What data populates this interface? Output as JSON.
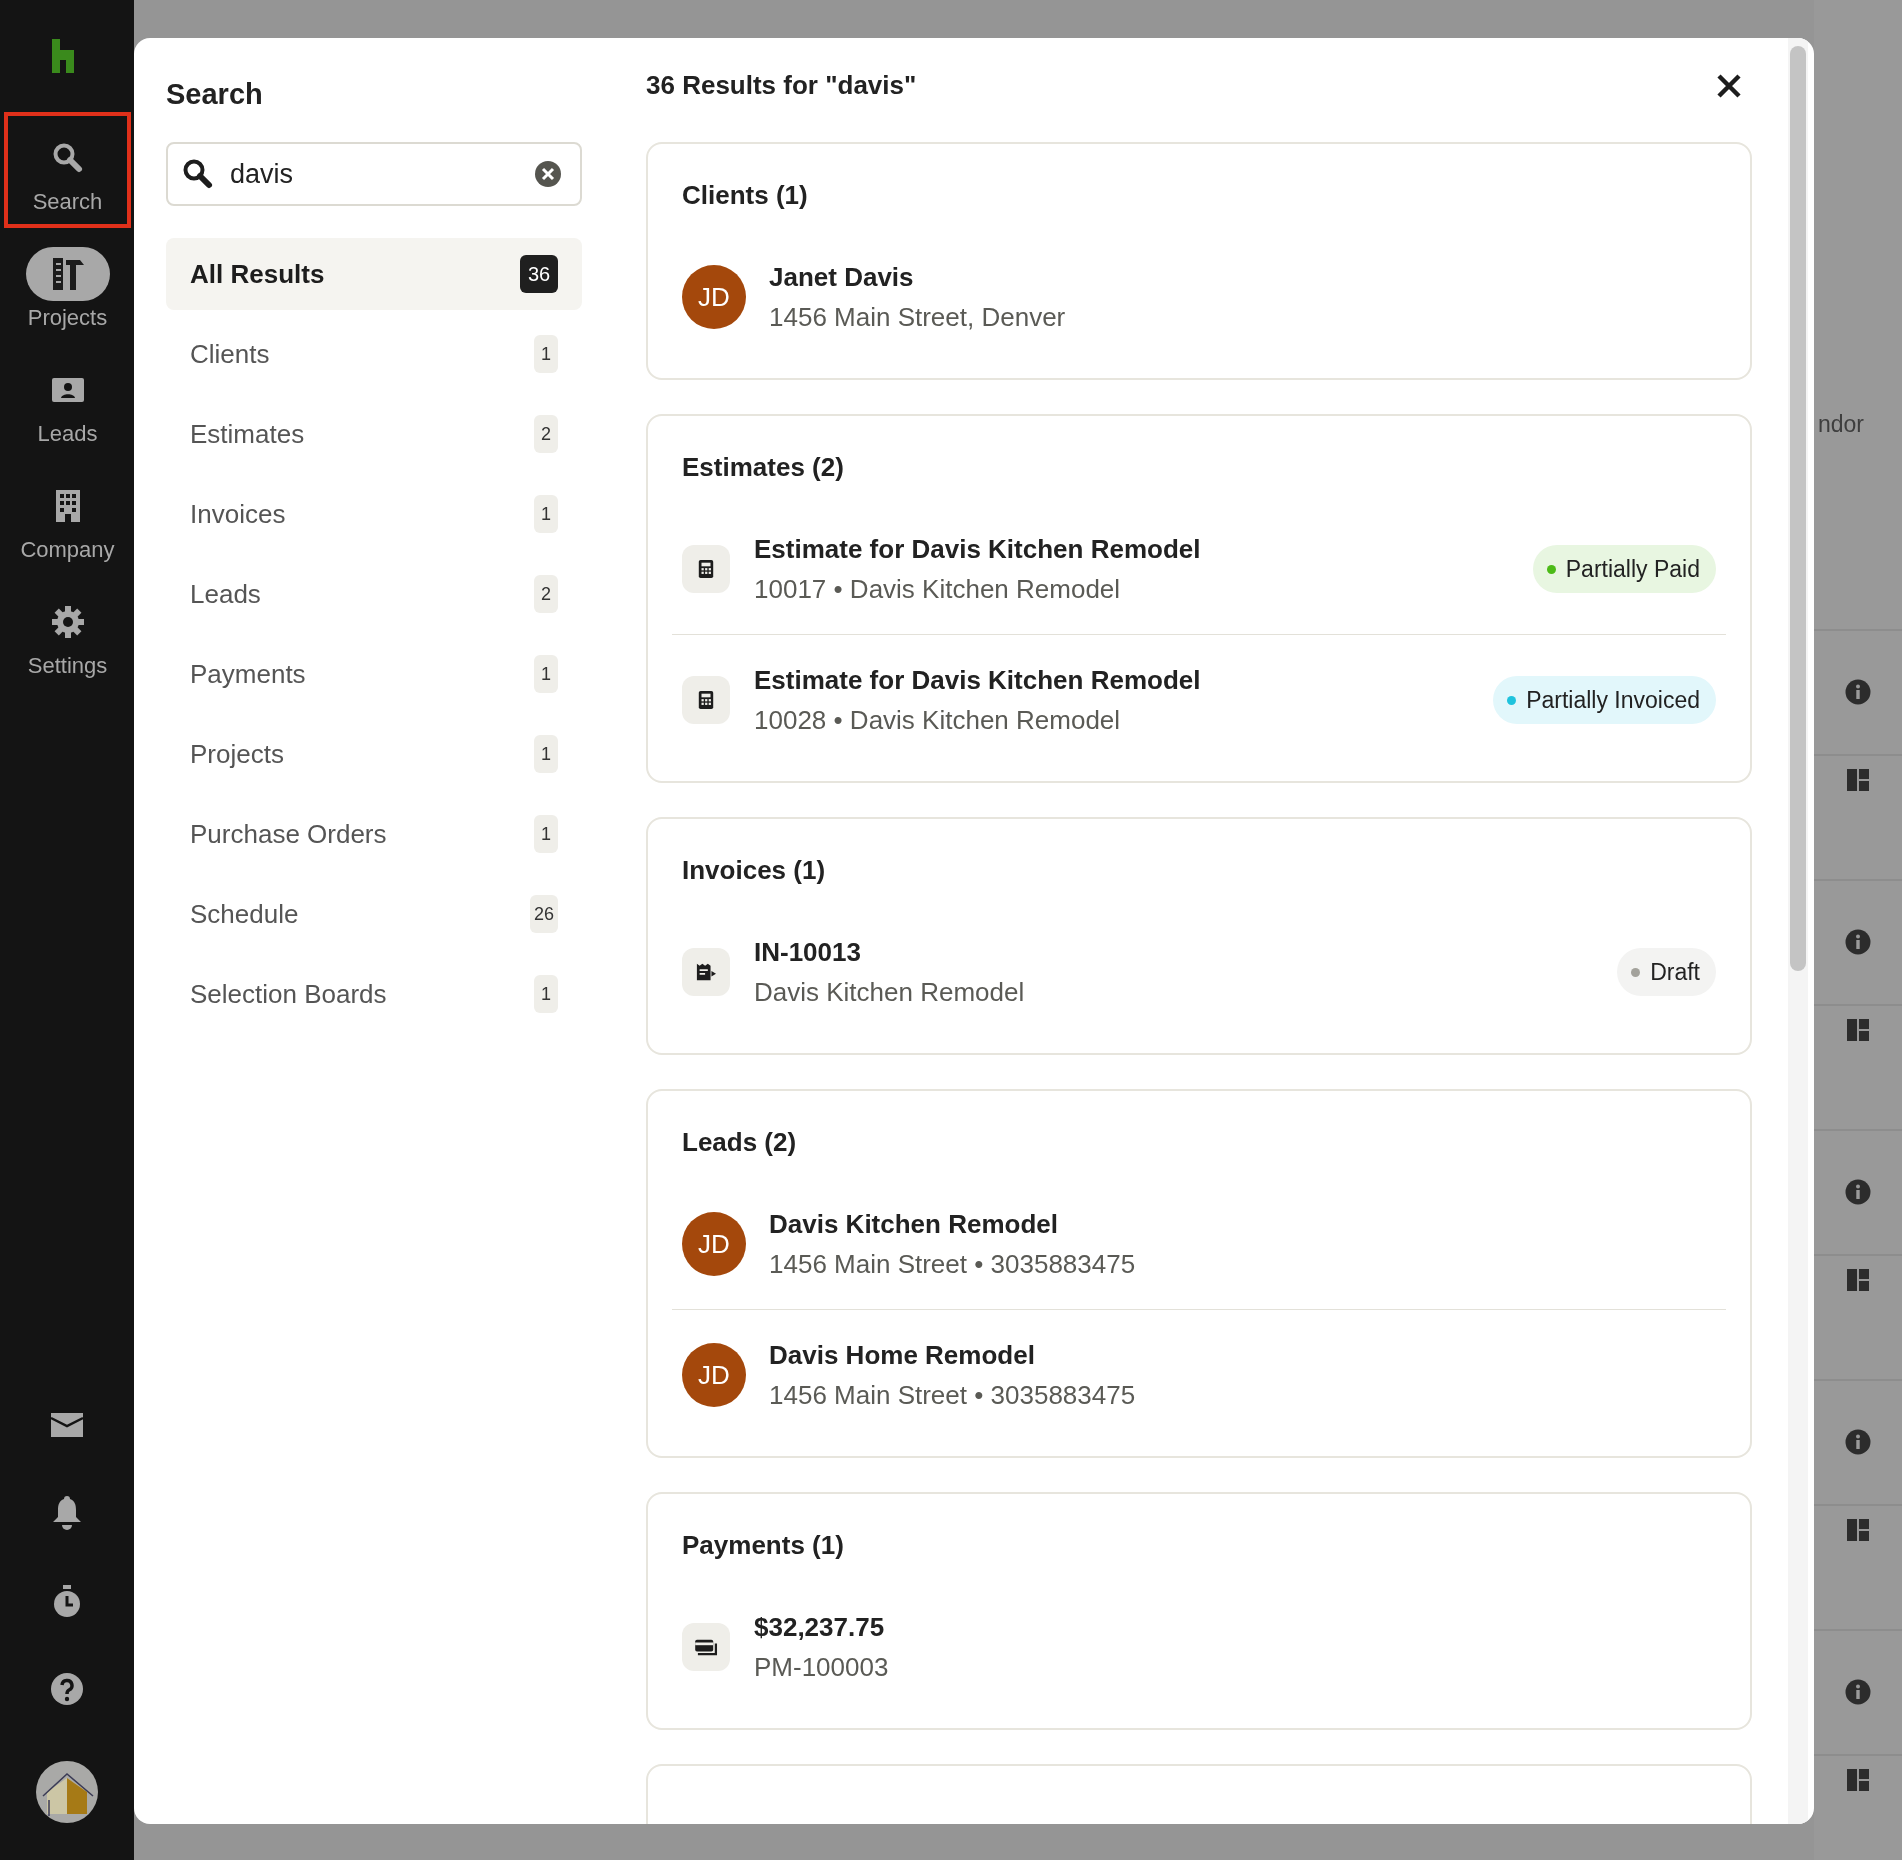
{
  "sidebar": {
    "items": [
      {
        "label": "Search",
        "kind": "search",
        "selected": false,
        "outlined": true
      },
      {
        "label": "Projects",
        "kind": "projects",
        "selected": true,
        "outlined": false
      },
      {
        "label": "Leads",
        "kind": "leads",
        "selected": false,
        "outlined": false
      },
      {
        "label": "Company",
        "kind": "company",
        "selected": false,
        "outlined": false
      },
      {
        "label": "Settings",
        "kind": "settings",
        "selected": false,
        "outlined": false
      }
    ],
    "bottom_items": [
      {
        "kind": "mail"
      },
      {
        "kind": "bell"
      },
      {
        "kind": "timer"
      },
      {
        "kind": "help"
      },
      {
        "kind": "avatar"
      }
    ]
  },
  "search_panel": {
    "title": "Search",
    "search_field": {
      "value": "davis"
    },
    "filters": [
      {
        "label": "All Results",
        "count": "36",
        "selected": true
      },
      {
        "label": "Clients",
        "count": "1",
        "selected": false
      },
      {
        "label": "Estimates",
        "count": "2",
        "selected": false
      },
      {
        "label": "Invoices",
        "count": "1",
        "selected": false
      },
      {
        "label": "Leads",
        "count": "2",
        "selected": false
      },
      {
        "label": "Payments",
        "count": "1",
        "selected": false
      },
      {
        "label": "Projects",
        "count": "1",
        "selected": false
      },
      {
        "label": "Purchase Orders",
        "count": "1",
        "selected": false
      },
      {
        "label": "Schedule",
        "count": "26",
        "selected": false
      },
      {
        "label": "Selection Boards",
        "count": "1",
        "selected": false
      }
    ]
  },
  "results": {
    "heading": "36 Results for \"davis\"",
    "sections": [
      {
        "title": "Clients (1)",
        "items": [
          {
            "kind": "person",
            "initials": "JD",
            "title": "Janet Davis",
            "subtitle": "1456 Main Street, Denver"
          }
        ]
      },
      {
        "title": "Estimates (2)",
        "items": [
          {
            "kind": "estimate",
            "title": "Estimate for Davis Kitchen Remodel",
            "subtitle": "10017 • Davis Kitchen Remodel",
            "status": {
              "label": "Partially Paid",
              "color": "#4cbb17"
            }
          },
          {
            "kind": "estimate",
            "title": "Estimate for Davis Kitchen Remodel",
            "subtitle": "10028 • Davis Kitchen Remodel",
            "status": {
              "label": "Partially Invoiced",
              "color": "#1fc3dd"
            }
          }
        ]
      },
      {
        "title": "Invoices (1)",
        "items": [
          {
            "kind": "invoice",
            "title": "IN-10013",
            "subtitle": "Davis Kitchen Remodel",
            "status": {
              "label": "Draft",
              "color": "#a3a29c"
            }
          }
        ]
      },
      {
        "title": "Leads (2)",
        "items": [
          {
            "kind": "person",
            "initials": "JD",
            "title": "Davis Kitchen Remodel",
            "subtitle": "1456 Main Street • 3035883475"
          },
          {
            "kind": "person",
            "initials": "JD",
            "title": "Davis Home Remodel",
            "subtitle": "1456 Main Street • 3035883475"
          }
        ]
      },
      {
        "title": "Payments (1)",
        "items": [
          {
            "kind": "payment",
            "title": "$32,237.75",
            "subtitle": "PM-100003"
          }
        ]
      }
    ]
  },
  "background": {
    "column_text": "ndor",
    "row_icons": [
      {
        "kind": "info"
      },
      {
        "kind": "layout"
      },
      {
        "kind": "info"
      },
      {
        "kind": "layout"
      },
      {
        "kind": "info"
      },
      {
        "kind": "layout"
      },
      {
        "kind": "info"
      },
      {
        "kind": "layout"
      },
      {
        "kind": "info"
      },
      {
        "kind": "layout"
      }
    ]
  }
}
